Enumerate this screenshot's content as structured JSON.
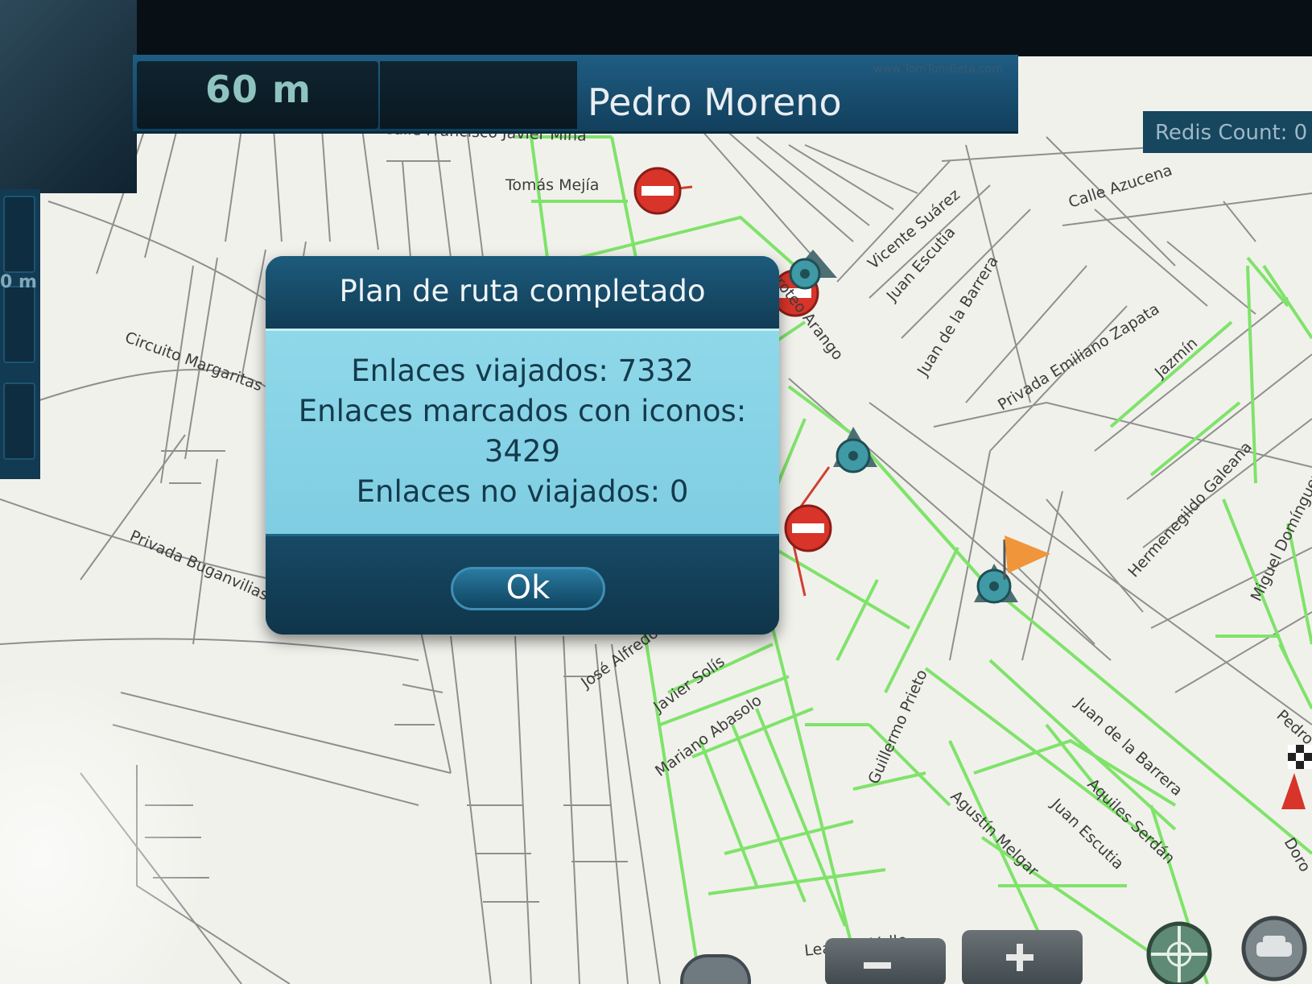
{
  "header": {
    "distance": "60 m",
    "street_name": "Pedro Moreno",
    "small_text": "www.TomTomBeta.com",
    "redis_count": "Redis Count: 0"
  },
  "left_strip": {
    "label": "0 m"
  },
  "dialog": {
    "title": "Plan de ruta completado",
    "line1": "Enlaces viajados: 7332",
    "line2": "Enlaces marcados con iconos:",
    "line3": "3429",
    "line4": "Enlaces no viajados: 0",
    "ok_label": "Ok"
  },
  "map": {
    "streets": {
      "calle_francisco_javier_mina": "Calle Francisco Javier Mina",
      "tomas_mejia": "Tomás Mejía",
      "vicente_suarez": "Vicente Suárez",
      "juan_escutia_1": "Juan Escutia",
      "juan_de_la_barrera_1": "Juan de la Barrera",
      "calle_azucena": "Calle Azucena",
      "doroteo_arango": "Doroteo Arango",
      "privada_emiliano_zapata": "Privada Emiliano Zapata",
      "jazmin": "Jazmín",
      "circuito_margaritas": "Circuito Margaritas",
      "privada_buganvilias": "Privada Buganvilias",
      "hermenegildo_galeana": "Hermenegildo Galeana",
      "miguel_dominguez": "Miguel Domínguez",
      "jose_alfredo": "José Alfredo",
      "javier_solis": "Javier Solís",
      "mariano_abasolo": "Mariano Abasolo",
      "guillermo_prieto": "Guillermo Prieto",
      "juan_de_la_barrera_2": "Juan de la Barrera",
      "aquiles_serdan": "Aquiles Serdán",
      "juan_escutia_2": "Juan Escutia",
      "agustin_melgar": "Agustín Melgar",
      "leandro_valle": "Leandro Valle",
      "pedro_partial": "Pedro",
      "doro_partial": "Doro"
    }
  },
  "colors": {
    "travelled_road": "#7fe36a",
    "untravelled_road": "#8c8c8c",
    "map_background": "#f2f2ee",
    "no_entry_red": "#d8342a",
    "flag_orange": "#f0953a"
  },
  "controls": {
    "zoom_out_icon": "minus",
    "zoom_in_icon": "plus",
    "compass_icon": "compass",
    "vehicle_icon": "car"
  }
}
